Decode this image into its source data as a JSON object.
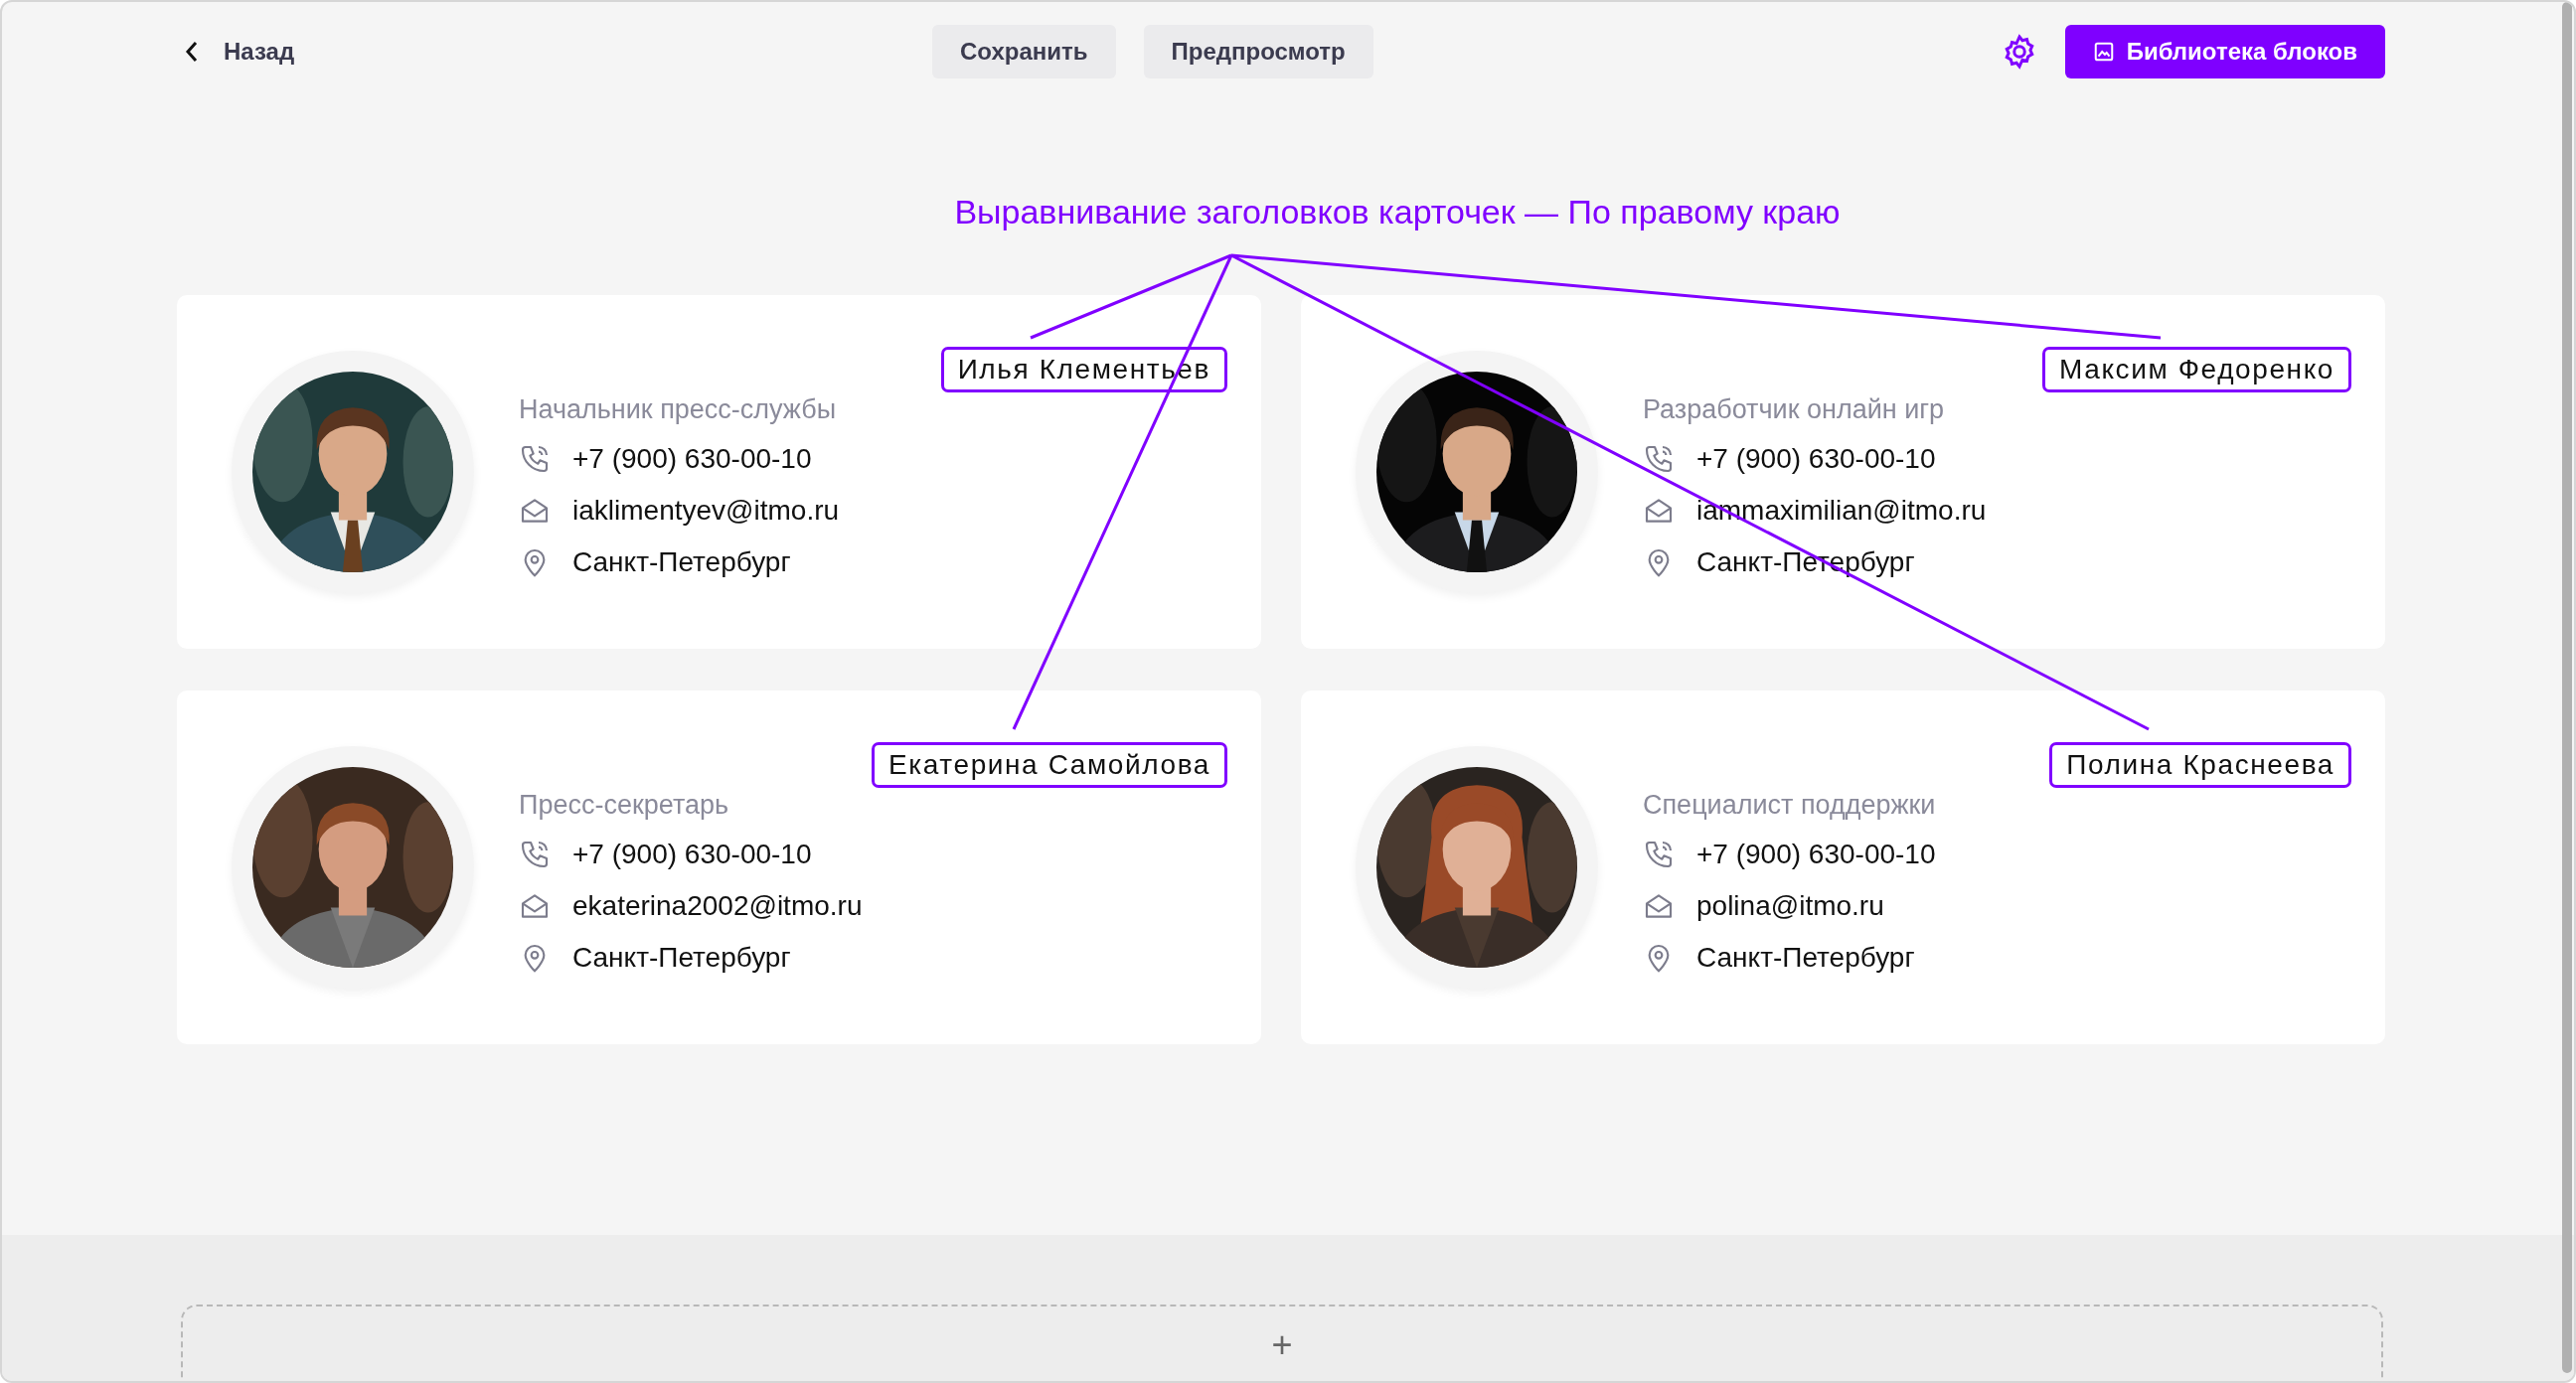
{
  "toolbar": {
    "back": "Назад",
    "buttons": [
      "Сохранить",
      "Предпросмотр"
    ],
    "library_button": "Библиотека блоков"
  },
  "annotation": {
    "title": "Выравнивание заголовков карточек — По правому краю"
  },
  "cards": [
    {
      "name": "Илья Клементьев",
      "role": "Начальник пресс-службы",
      "phone": "+7 (900) 630-00-10",
      "email": "iaklimentyev@itmo.ru",
      "city": "Санкт-Петербург"
    },
    {
      "name": "Максим Федоренко",
      "role": "Разработчик онлайн игр",
      "phone": "+7 (900) 630-00-10",
      "email": "iammaximilian@itmo.ru",
      "city": "Санкт-Петербург"
    },
    {
      "name": "Екатерина Самойлова",
      "role": "Пресс-секретарь",
      "phone": "+7 (900) 630-00-10",
      "email": "ekaterina2002@itmo.ru",
      "city": "Санкт-Петербург"
    },
    {
      "name": "Полина Краснеева",
      "role": "Специалист поддержки",
      "phone": "+7 (900) 630-00-10",
      "email": "polina@itmo.ru",
      "city": "Санкт-Петербург"
    }
  ],
  "add_block": {
    "label": "+"
  }
}
